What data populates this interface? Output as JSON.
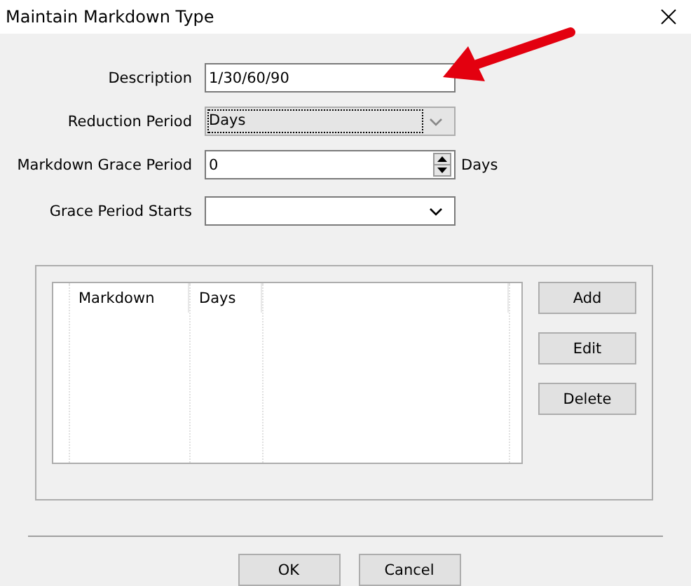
{
  "window": {
    "title": "Maintain Markdown Type"
  },
  "form": [
    {
      "label": "Description",
      "kind": "text",
      "value": "1/30/60/90",
      "focused": false
    },
    {
      "label": "Reduction Period",
      "kind": "list",
      "value": "Days",
      "focused": true
    },
    {
      "label": "Markdown Grace Period",
      "kind": "spin",
      "value": "0",
      "suffix": "Days",
      "focused": false
    },
    {
      "label": "Grace Period Starts",
      "kind": "combo",
      "focused": false
    }
  ],
  "table": {
    "columns": [
      "Markdown",
      "Days"
    ]
  },
  "side_buttons": [
    "Add",
    "Edit",
    "Delete"
  ],
  "buttons": [
    "OK",
    "Cancel"
  ]
}
